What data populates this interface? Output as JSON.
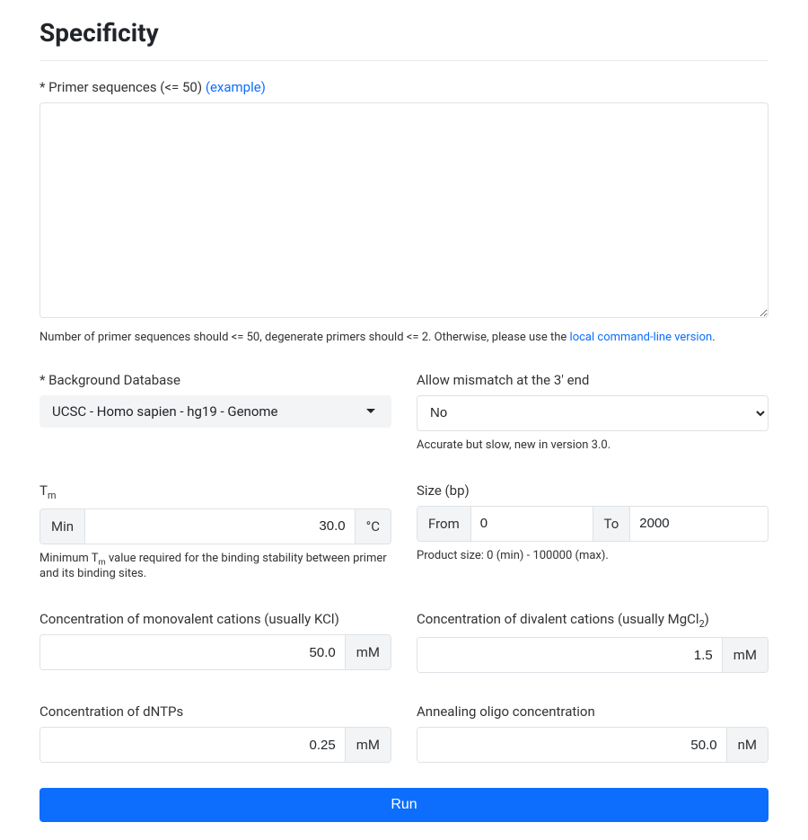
{
  "title": "Specificity",
  "primer_section": {
    "label_prefix": "* Primer sequences (<= 50) ",
    "example_link": "(example)",
    "help_prefix": "Number of primer sequences should <= 50, degenerate primers should <= 2. Otherwise, please use the ",
    "help_link": "local command-line version",
    "help_suffix": "."
  },
  "background_db": {
    "label": "* Background Database",
    "selected": "UCSC - Homo sapien - hg19 - Genome"
  },
  "mismatch": {
    "label": "Allow mismatch at the 3' end",
    "selected": "No",
    "hint": "Accurate but slow, new in version 3.0."
  },
  "tm": {
    "label_main": "T",
    "label_sub": "m",
    "addon_label": "Min",
    "value": "30.0",
    "unit": "°C",
    "hint_pre": "Minimum T",
    "hint_sub": "m",
    "hint_post": " value required for the binding stability between primer and its binding sites."
  },
  "size": {
    "label": "Size (bp)",
    "from_label": "From",
    "from_value": "0",
    "to_label": "To",
    "to_value": "2000",
    "hint": "Product size: 0 (min) - 100000 (max)."
  },
  "mono": {
    "label": "Concentration of monovalent cations (usually KCl)",
    "value": "50.0",
    "unit": "mM"
  },
  "diva": {
    "label_main": "Concentration of divalent cations (usually MgCl",
    "label_sub": "2",
    "label_end": ")",
    "value": "1.5",
    "unit": "mM"
  },
  "dntp": {
    "label": "Concentration of dNTPs",
    "value": "0.25",
    "unit": "mM"
  },
  "anneal": {
    "label": "Annealing oligo concentration",
    "value": "50.0",
    "unit": "nM"
  },
  "run_label": "Run"
}
